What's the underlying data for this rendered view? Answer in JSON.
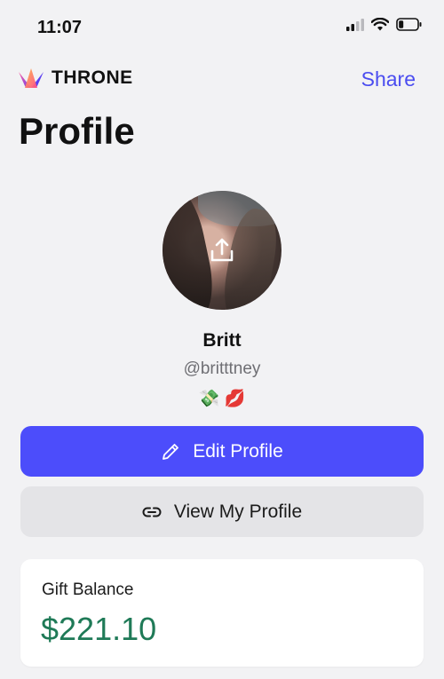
{
  "status_bar": {
    "time": "11:07",
    "icons": [
      "signal-icon",
      "wifi-icon",
      "battery-icon"
    ]
  },
  "header": {
    "brand_name": "THRONE",
    "brand_icon": "crown-logo-icon",
    "share_label": "Share"
  },
  "page": {
    "title": "Profile"
  },
  "profile": {
    "avatar_icon": "upload-icon",
    "display_name": "Britt",
    "handle": "@britttney",
    "emojis": "💸 💋"
  },
  "actions": {
    "edit_label": "Edit Profile",
    "edit_icon": "pencil-icon",
    "view_label": "View My Profile",
    "view_icon": "link-icon"
  },
  "gift_balance": {
    "label": "Gift Balance",
    "value": "$221.10"
  },
  "colors": {
    "accent": "#4c4dfb",
    "balance": "#1f7a57",
    "share": "#4b4df0",
    "background": "#f2f2f4"
  }
}
